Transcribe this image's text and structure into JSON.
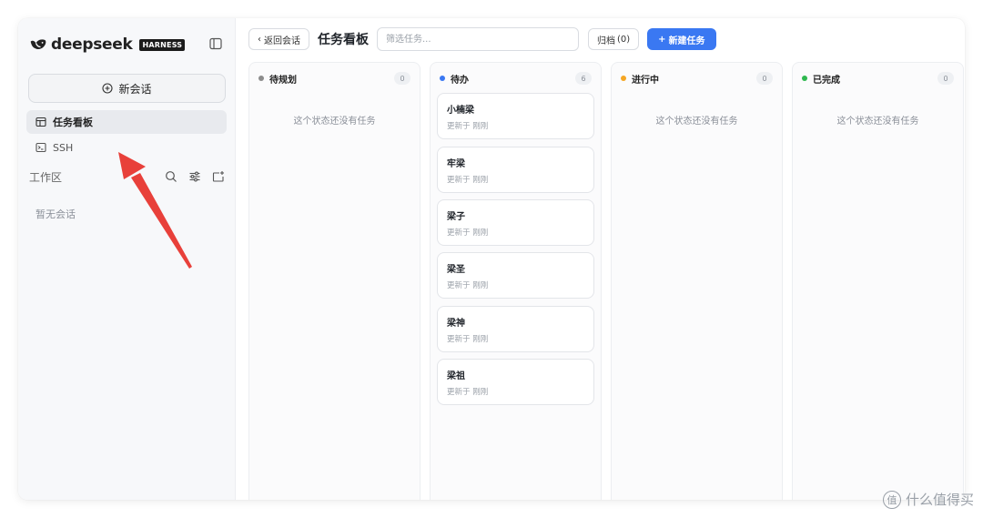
{
  "brand": {
    "name": "deepseek",
    "badge": "HARNESS",
    "logo_icon": "whale-icon"
  },
  "sidebar": {
    "new_chat_label": "新会话",
    "nav": [
      {
        "label": "任务看板",
        "icon": "board-icon",
        "active": true
      },
      {
        "label": "SSH",
        "icon": "terminal-icon",
        "active": false
      }
    ],
    "workspace_label": "工作区",
    "workspace_icons": [
      "search-icon",
      "filter-icon",
      "new-folder-icon"
    ],
    "empty_text": "暂无会话"
  },
  "toolbar": {
    "back_label": "返回会话",
    "title": "任务看板",
    "filter_placeholder": "筛选任务...",
    "archive_label": "归档",
    "archive_count": "(0)",
    "new_task_label": "新建任务"
  },
  "columns": [
    {
      "title": "待规划",
      "count": "0",
      "dot_color": "#8c8c8c",
      "empty_text": "这个状态还没有任务",
      "cards": []
    },
    {
      "title": "待办",
      "count": "6",
      "dot_color": "#3a78f2",
      "empty_text": "",
      "cards": [
        {
          "title": "小楠梁",
          "sub": "更新于 刚刚"
        },
        {
          "title": "牢梁",
          "sub": "更新于 刚刚"
        },
        {
          "title": "梁子",
          "sub": "更新于 刚刚"
        },
        {
          "title": "梁圣",
          "sub": "更新于 刚刚"
        },
        {
          "title": "梁神",
          "sub": "更新于 刚刚"
        },
        {
          "title": "梁祖",
          "sub": "更新于 刚刚"
        }
      ]
    },
    {
      "title": "进行中",
      "count": "0",
      "dot_color": "#f5a623",
      "empty_text": "这个状态还没有任务",
      "cards": []
    },
    {
      "title": "已完成",
      "count": "0",
      "dot_color": "#2fb84f",
      "empty_text": "这个状态还没有任务",
      "cards": []
    }
  ],
  "colors": {
    "accent": "#3a78f2",
    "annotation_arrow": "#e8403a"
  },
  "watermark": {
    "icon_text": "值",
    "text": "什么值得买"
  }
}
